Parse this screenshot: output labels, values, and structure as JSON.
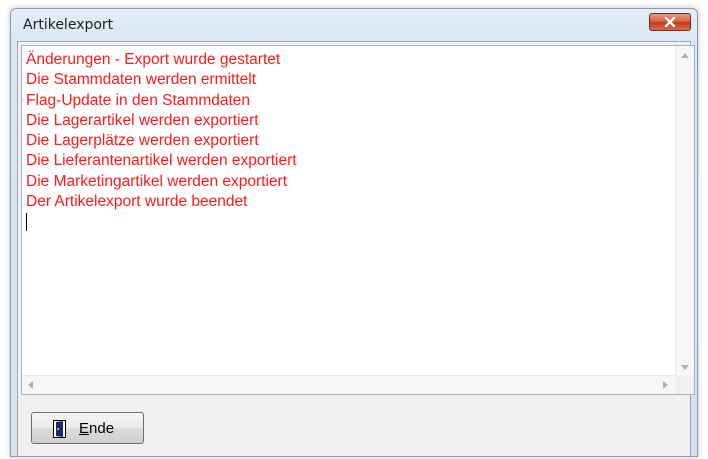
{
  "window": {
    "title": "Artikelexport",
    "close_icon": "close-icon"
  },
  "log": {
    "lines": [
      "Änderungen - Export wurde gestartet",
      "Die Stammdaten werden ermittelt",
      "Flag-Update in den Stammdaten",
      "Die Lagerartikel werden exportiert",
      "Die Lagerplätze werden exportiert",
      "Die Lieferantenartikel werden exportiert",
      "Die Marketingartikel werden exportiert",
      "Der Artikelexport wurde beendet"
    ],
    "text_color": "#ff1a1a"
  },
  "footer": {
    "ende_button": {
      "mnemonic": "E",
      "rest": "nde",
      "icon": "door-icon"
    }
  },
  "colors": {
    "close_button": "#c13a1c",
    "window_frame": "#dbe7f4"
  }
}
